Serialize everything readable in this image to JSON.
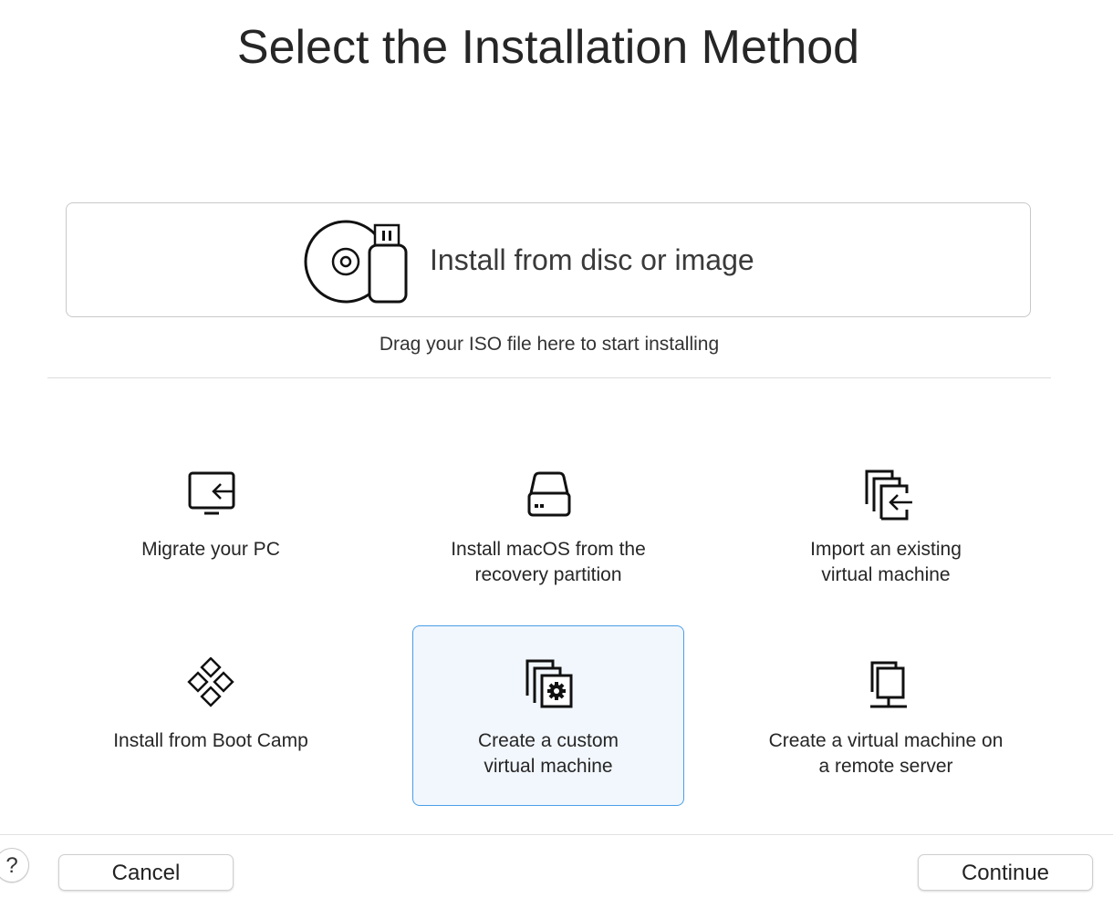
{
  "title": "Select the Installation Method",
  "drop_zone": {
    "label": "Install from disc or image",
    "icon": "disc-usb-icon",
    "hint": "Drag your ISO file here to start installing"
  },
  "options": [
    {
      "label": "Migrate your PC",
      "icon": "migrate-pc-icon",
      "selected": false
    },
    {
      "label": "Install macOS from the\nrecovery partition",
      "icon": "hard-drive-icon",
      "selected": false
    },
    {
      "label": "Import an existing\nvirtual machine",
      "icon": "import-vm-icon",
      "selected": false
    },
    {
      "label": "Install from Boot Camp",
      "icon": "boot-camp-icon",
      "selected": false
    },
    {
      "label": "Create a custom\nvirtual machine",
      "icon": "custom-vm-gear-icon",
      "selected": true
    },
    {
      "label": "Create a virtual machine on\na remote server",
      "icon": "remote-server-icon",
      "selected": false
    }
  ],
  "footer": {
    "help_label": "?",
    "cancel_label": "Cancel",
    "continue_label": "Continue"
  },
  "colors": {
    "selected_border": "#4a9ee8",
    "selected_background": "#f2f7fd"
  }
}
